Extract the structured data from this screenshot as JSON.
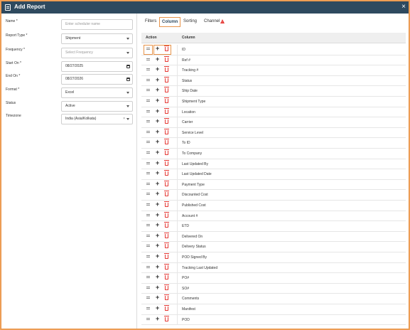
{
  "dialog": {
    "title": "Add Report"
  },
  "form": {
    "name": {
      "label": "Name *",
      "placeholder": "Enter scheduler name"
    },
    "report_type": {
      "label": "Report Type *",
      "value": "Shipment"
    },
    "frequency": {
      "label": "Frequency *",
      "placeholder": "Select Frequency"
    },
    "start_on": {
      "label": "Start On *",
      "value": "08/27/2025"
    },
    "end_on": {
      "label": "End On *",
      "value": "08/27/2026"
    },
    "format": {
      "label": "Format *",
      "value": "Excel"
    },
    "status": {
      "label": "Status",
      "value": "Active"
    },
    "timezone": {
      "label": "Timezone",
      "value": "India (Asia/Kolkata)"
    }
  },
  "tabs": [
    {
      "label": "Filters"
    },
    {
      "label": "Column"
    },
    {
      "label": "Sorting"
    },
    {
      "label": "Channel"
    }
  ],
  "table": {
    "headers": {
      "action": "Action",
      "column": "Column"
    },
    "rows": [
      "ID",
      "Ref #",
      "Tracking #",
      "Status",
      "Ship Date",
      "Shipment Type",
      "Location",
      "Carrier",
      "Service Level",
      "To ID",
      "To Company",
      "Last Updated By",
      "Last Updated Date",
      "Payment Type",
      "Discounted Cost",
      "Published Cost",
      "Account #",
      "ETD",
      "Delivered On",
      "Delivery Status",
      "POD Signed By",
      "Tracking Last Updated",
      "PO#",
      "SO#",
      "Comments",
      "Manifest",
      "POD"
    ]
  }
}
